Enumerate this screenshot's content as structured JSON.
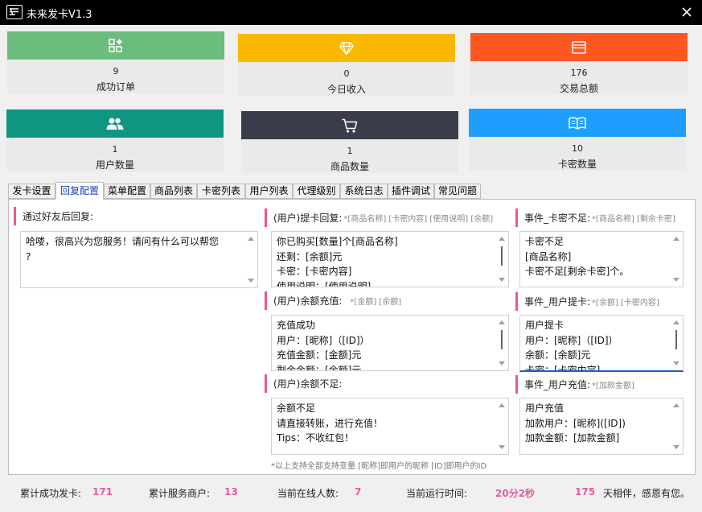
{
  "window": {
    "title": "未来发卡V1.3"
  },
  "colors": {
    "green": "#6cbc7e",
    "yellow": "#fbb800",
    "orange": "#fe5722",
    "teal": "#0f9683",
    "dark": "#393d49",
    "blue": "#1e9fff",
    "accent": "#e95b85"
  },
  "cards": [
    {
      "value": "9",
      "label": "成功订单",
      "icon": "apps-icon"
    },
    {
      "value": "0",
      "label": "今日收入",
      "icon": "diamond-icon"
    },
    {
      "value": "176",
      "label": "交易总额",
      "icon": "window-icon"
    },
    {
      "value": "1",
      "label": "用户数量",
      "icon": "users-icon"
    },
    {
      "value": "1",
      "label": "商品数量",
      "icon": "cart-icon"
    },
    {
      "value": "10",
      "label": "卡密数量",
      "icon": "book-icon"
    }
  ],
  "tabs": [
    "发卡设置",
    "回复配置",
    "菜单配置",
    "商品列表",
    "卡密列表",
    "用户列表",
    "代理级别",
    "系统日志",
    "插件调试",
    "常见问题"
  ],
  "sections": {
    "friend": {
      "title": "通过好友后回复:",
      "vars": "",
      "text": "哈喽，很高兴为您服务！请问有什么可以帮您\n?"
    },
    "pickup": {
      "title": "(用户)提卡回复:",
      "vars": "*[商品名称] [卡密内容] [使用说明] [余额]",
      "text": "你已购买[数量]个[商品名称]\n还剩：[余额]元\n卡密：[卡密内容]\n使用说明：[使用说明]"
    },
    "recharge": {
      "title": "(用户)余额充值:",
      "vars": "*[金额] [余额]",
      "text": "充值成功\n用户：[昵称]（[ID]）\n充值金额：[金额]元\n剩余余额：[余额]元"
    },
    "insufficient": {
      "title": "(用户)余额不足:",
      "vars": "",
      "text": "余额不足\n请直接转账，进行充值！\nTips：不收红包！"
    },
    "card_short": {
      "title": "事件_卡密不足:",
      "vars": "*[商品名称] [剩余卡密]",
      "text": "卡密不足\n[商品名称]\n卡密不足[剩余卡密]个。"
    },
    "user_pickup": {
      "title": "事件_用户提卡:",
      "vars": "*[余额] [卡密内容]",
      "text": "用户提卡\n用户：[昵称]（[ID]）\n余额：[余额]元\n卡密：[卡密内容]"
    },
    "user_recharge": {
      "title": "事件_用户充值:",
      "vars": "*[加款金额]",
      "text": "用户充值\n加款用户：[昵称]([ID])\n加款金额：[加款金额]"
    }
  },
  "footnote": "*以上支持全部支持变量 [昵称]即用户的昵称 [ID]即用户的ID",
  "status": {
    "total_label": "累计成功发卡:",
    "total": "171",
    "merchants_label": "累计服务商户:",
    "merchants": "13",
    "online_label": "当前在线人数:",
    "online": "7",
    "runtime_label": "当前运行时间:",
    "runtime": "20分2秒",
    "days": "175",
    "days_suffix": "天相伴，感恩有您。"
  }
}
